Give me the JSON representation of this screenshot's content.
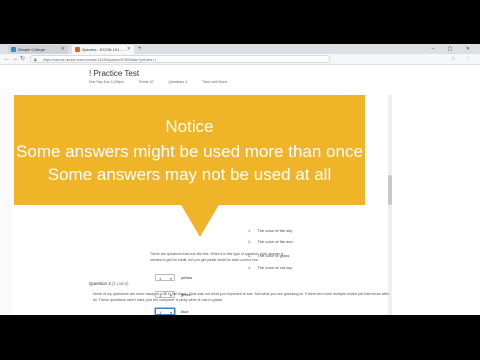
{
  "browser": {
    "tabs": [
      {
        "label": "Simple College"
      },
      {
        "label": "Quizzes - ECON 101 - ..."
      }
    ],
    "new_tab": "+",
    "url": "https://canvas.ubuntu.edu/courses/12345/quizzes/67890/take?preview=1",
    "window_controls": "– ▢ ✕"
  },
  "quiz": {
    "title": "! Practice Test",
    "meta": [
      "Due Sep 8 at 11:59pm",
      "Points 10",
      "Questions 4",
      "Time Limit None"
    ]
  },
  "question": {
    "intro": "These are questions that look like this. When it is this type of question, each answer is",
    "intro2": "needed to get full credit, but you get partial credit for each correct one.",
    "rows": [
      {
        "value": "1",
        "option": "yellow"
      },
      {
        "value": "1",
        "option": "green"
      },
      {
        "value": "1",
        "option": "blue"
      }
    ],
    "answers": [
      {
        "num": "1.",
        "text": "The color of the sky"
      },
      {
        "num": "2.",
        "text": "The color of the sun"
      },
      {
        "num": "3.",
        "text": "The color of grass"
      },
      {
        "num": "4.",
        "text": "The color of old cup"
      }
    ]
  },
  "next_question": {
    "label": "Question 3",
    "points": "(1 point)",
    "text": "None of my questions are more essay or a fill in the blank. That was not what you expected to see. Not what you are guessing at. If there are more multiple choice job interviews after all. These questions aren't hard, just the computer is picky when it has to grade."
  },
  "notice": {
    "title": "Notice",
    "line1": "Some answers might be used more than once",
    "line2": "Some answers may not be used at all"
  },
  "colors": {
    "notice_bg": "#f0b429",
    "notice_text": "#ffffff"
  }
}
